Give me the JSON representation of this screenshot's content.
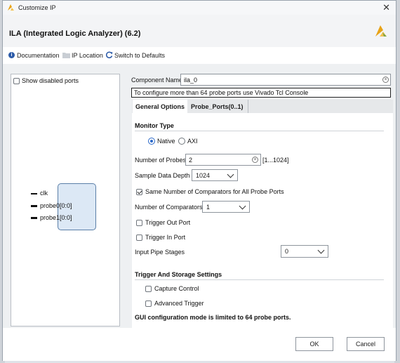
{
  "window": {
    "title": "Customize IP",
    "close_glyph": "✕"
  },
  "header": {
    "ip_title": "ILA (Integrated Logic Analyzer) (6.2)"
  },
  "toolbar": {
    "documentation": "Documentation",
    "ip_location": "IP Location",
    "switch_defaults": "Switch to Defaults"
  },
  "left_panel": {
    "show_disabled_ports": "Show disabled ports",
    "ports": [
      "clk",
      "probe0[0:0]",
      "probe1[0:0]"
    ]
  },
  "component": {
    "label": "Component Name",
    "value": "ila_0",
    "note": "To configure more than 64 probe ports use Vivado Tcl Console"
  },
  "tabs": [
    "General Options",
    "Probe_Ports(0..1)"
  ],
  "monitor": {
    "title": "Monitor Type",
    "native": "Native",
    "axi": "AXI",
    "num_probes_label": "Number of Probes",
    "num_probes_value": "2",
    "num_probes_range": "[1...1024]",
    "sample_depth_label": "Sample Data Depth",
    "sample_depth_value": "1024",
    "same_comparators": "Same Number of Comparators for All Probe Ports",
    "num_comparators_label": "Number of Comparators",
    "num_comparators_value": "1",
    "trigger_out": "Trigger Out Port",
    "trigger_in": "Trigger In Port",
    "input_pipe_label": "Input Pipe Stages",
    "input_pipe_value": "0"
  },
  "trigger_storage": {
    "title": "Trigger And Storage Settings",
    "capture_control": "Capture Control",
    "advanced_trigger": "Advanced Trigger",
    "gui_note": "GUI configuration mode is limited to 64 probe ports."
  },
  "footer": {
    "ok": "OK",
    "cancel": "Cancel"
  },
  "colors": {
    "accent": "#2b69c9",
    "logo": "#e8a317"
  }
}
